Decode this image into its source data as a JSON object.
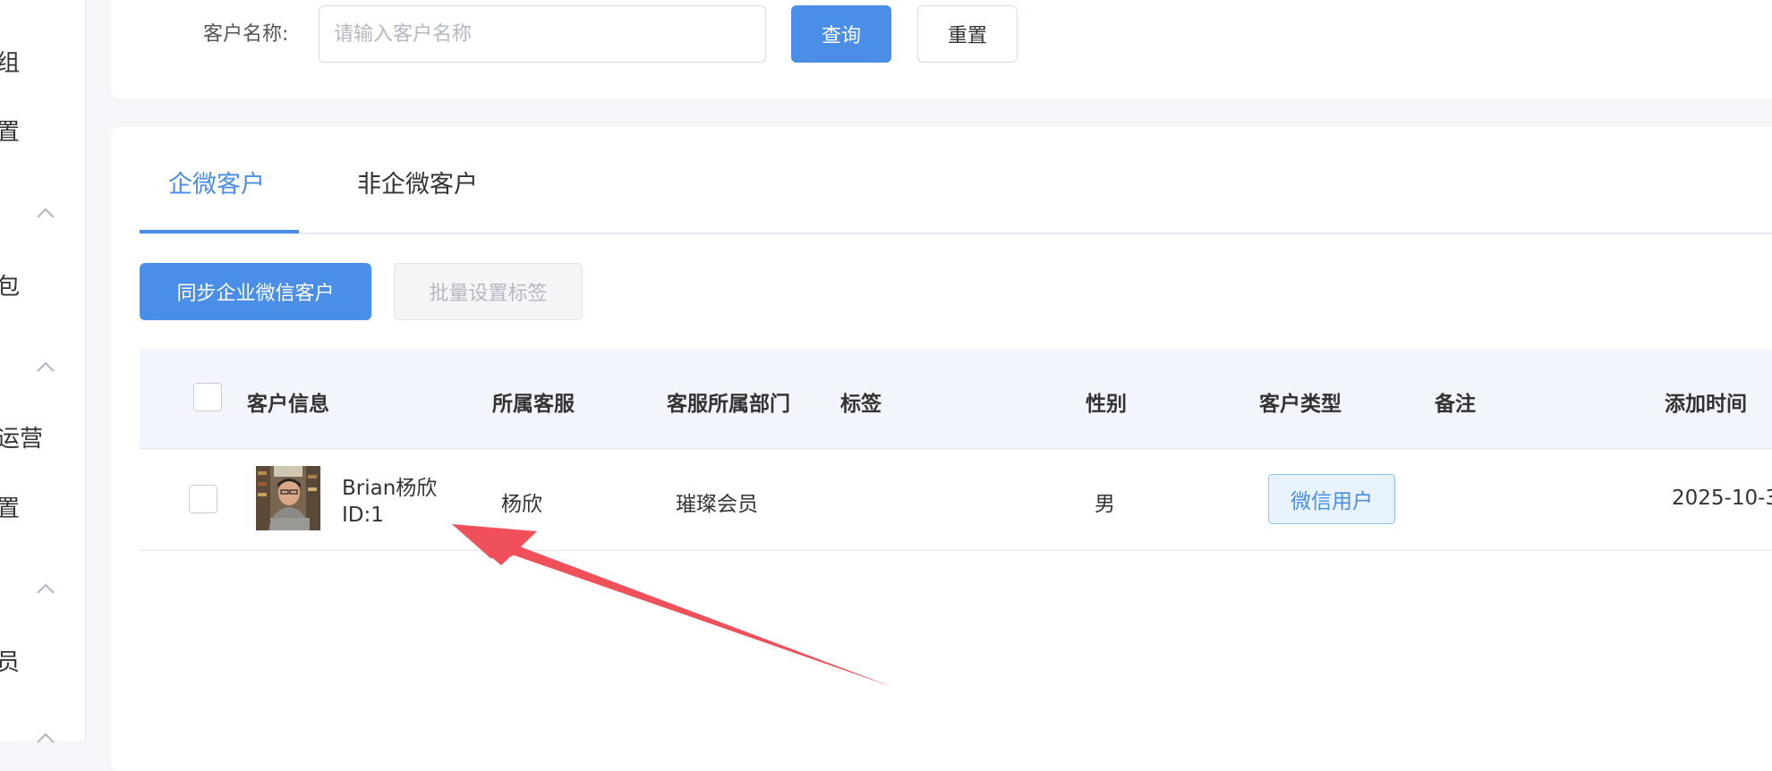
{
  "sidebar": {
    "items": [
      {
        "label": "组"
      },
      {
        "label": "置"
      },
      {
        "label": "包"
      },
      {
        "label": "运营"
      },
      {
        "label": "置"
      },
      {
        "label": "员"
      }
    ]
  },
  "search": {
    "label": "客户名称:",
    "placeholder": "请输入客户名称",
    "query_label": "查询",
    "reset_label": "重置"
  },
  "tabs": [
    {
      "label": "企微客户",
      "active": true
    },
    {
      "label": "非企微客户",
      "active": false
    }
  ],
  "actions": {
    "sync_label": "同步企业微信客户",
    "batch_tag_label": "批量设置标签"
  },
  "table": {
    "columns": [
      "客户信息",
      "所属客服",
      "客服所属部门",
      "标签",
      "性别",
      "客户类型",
      "备注",
      "添加时间"
    ],
    "rows": [
      {
        "name": "Brian杨欣",
        "id": "ID:1",
        "agent": "杨欣",
        "department": "璀璨会员",
        "tags": "",
        "gender": "男",
        "type": "微信用户",
        "remark": "",
        "added_time": "2025-10-3"
      }
    ]
  },
  "colors": {
    "accent": "#4a8ee8",
    "annotation_arrow": "#f0505a"
  }
}
